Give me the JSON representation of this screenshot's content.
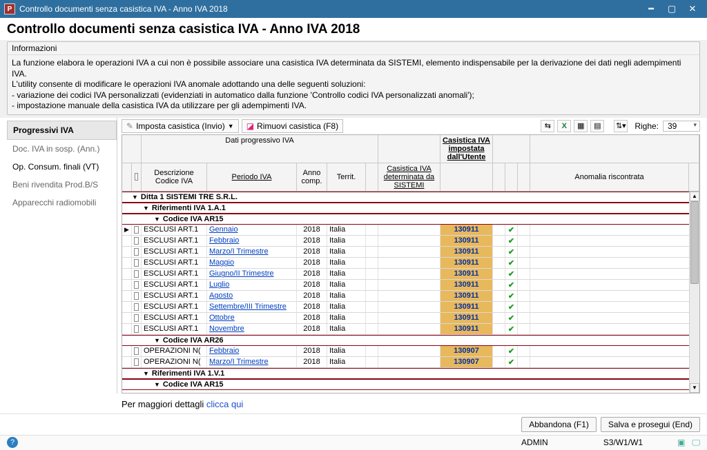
{
  "window": {
    "title": "Controllo documenti senza casistica IVA - Anno IVA 2018"
  },
  "header": {
    "title": "Controllo documenti senza casistica IVA - Anno IVA 2018"
  },
  "info": {
    "title": "Informazioni",
    "p1": "La funzione elabora le operazioni IVA a cui non è possibile associare una casistica IVA determinata da SISTEMI, elemento indispensabile per la derivazione dei dati negli adempimenti IVA.",
    "p2": "L'utility consente di modificare le operazioni IVA anomale adottando una delle seguenti soluzioni:",
    "p3": "- variazione dei codici IVA personalizzati (evidenziati in automatico dalla funzione 'Controllo codici IVA personalizzati anomali');",
    "p4": "- impostazione manuale della casistica IVA da utilizzare per gli adempimenti IVA."
  },
  "sidebar": {
    "items": [
      {
        "label": "Progressivi IVA",
        "active": true
      },
      {
        "label": "Doc. IVA in sosp. (Ann.)"
      },
      {
        "label": "Op. Consum. finali (VT)",
        "dark": true
      },
      {
        "label": "Beni rivendita Prod.B/S"
      },
      {
        "label": "Apparecchi radiomobili"
      }
    ]
  },
  "toolbar": {
    "imposta": "Imposta casistica (Invio)",
    "rimuovi": "Rimuovi casistica (F8)",
    "righe_label": "Righe:",
    "righe_value": "39"
  },
  "columns": {
    "group_dati": "Dati progressivo IVA",
    "desc": "Descrizione Codice IVA",
    "periodo": "Periodo IVA",
    "anno": "Anno comp.",
    "territ": "Territ.",
    "cas_sys": "Casistica IVA determinata da SISTEMI",
    "cas_user": "Casistica IVA impostata dall'Utente",
    "anomalia": "Anomalia riscontrata"
  },
  "groups": {
    "ditta": "Ditta 1 SISTEMI TRE S.R.L.",
    "rif1": "Riferimenti IVA 1.A.1",
    "codAR15": "Codice IVA AR15",
    "codAR26": "Codice IVA AR26",
    "rif2": "Riferimenti IVA 1.V.1",
    "codAR15b": "Codice IVA AR15"
  },
  "rows_ar15": [
    {
      "desc": "ESCLUSI ART.1",
      "period": "Gennaio",
      "anno": "2018",
      "terr": "Italia",
      "imp": "130911"
    },
    {
      "desc": "ESCLUSI ART.1",
      "period": "Febbraio",
      "anno": "2018",
      "terr": "Italia",
      "imp": "130911"
    },
    {
      "desc": "ESCLUSI ART.1",
      "period": "Marzo/I Trimestre",
      "anno": "2018",
      "terr": "Italia",
      "imp": "130911"
    },
    {
      "desc": "ESCLUSI ART.1",
      "period": "Maggio",
      "anno": "2018",
      "terr": "Italia",
      "imp": "130911"
    },
    {
      "desc": "ESCLUSI ART.1",
      "period": "Giugno/II Trimestre",
      "anno": "2018",
      "terr": "Italia",
      "imp": "130911"
    },
    {
      "desc": "ESCLUSI ART.1",
      "period": "Luglio",
      "anno": "2018",
      "terr": "Italia",
      "imp": "130911"
    },
    {
      "desc": "ESCLUSI ART.1",
      "period": "Agosto",
      "anno": "2018",
      "terr": "Italia",
      "imp": "130911"
    },
    {
      "desc": "ESCLUSI ART.1",
      "period": "Settembre/III Trimestre",
      "anno": "2018",
      "terr": "Italia",
      "imp": "130911"
    },
    {
      "desc": "ESCLUSI ART.1",
      "period": "Ottobre",
      "anno": "2018",
      "terr": "Italia",
      "imp": "130911"
    },
    {
      "desc": "ESCLUSI ART.1",
      "period": "Novembre",
      "anno": "2018",
      "terr": "Italia",
      "imp": "130911"
    }
  ],
  "rows_ar26": [
    {
      "desc": "OPERAZIONI N(",
      "period": "Febbraio",
      "anno": "2018",
      "terr": "Italia",
      "imp": "130907"
    },
    {
      "desc": "OPERAZIONI N(",
      "period": "Marzo/I Trimestre",
      "anno": "2018",
      "terr": "Italia",
      "imp": "130907"
    }
  ],
  "footer": {
    "text": "Per maggiori dettagli ",
    "link": "clicca qui"
  },
  "buttons": {
    "cancel": "Abbandona (F1)",
    "ok": "Salva e prosegui (End)"
  },
  "status": {
    "user": "ADMIN",
    "code": "S3/W1/W1"
  }
}
